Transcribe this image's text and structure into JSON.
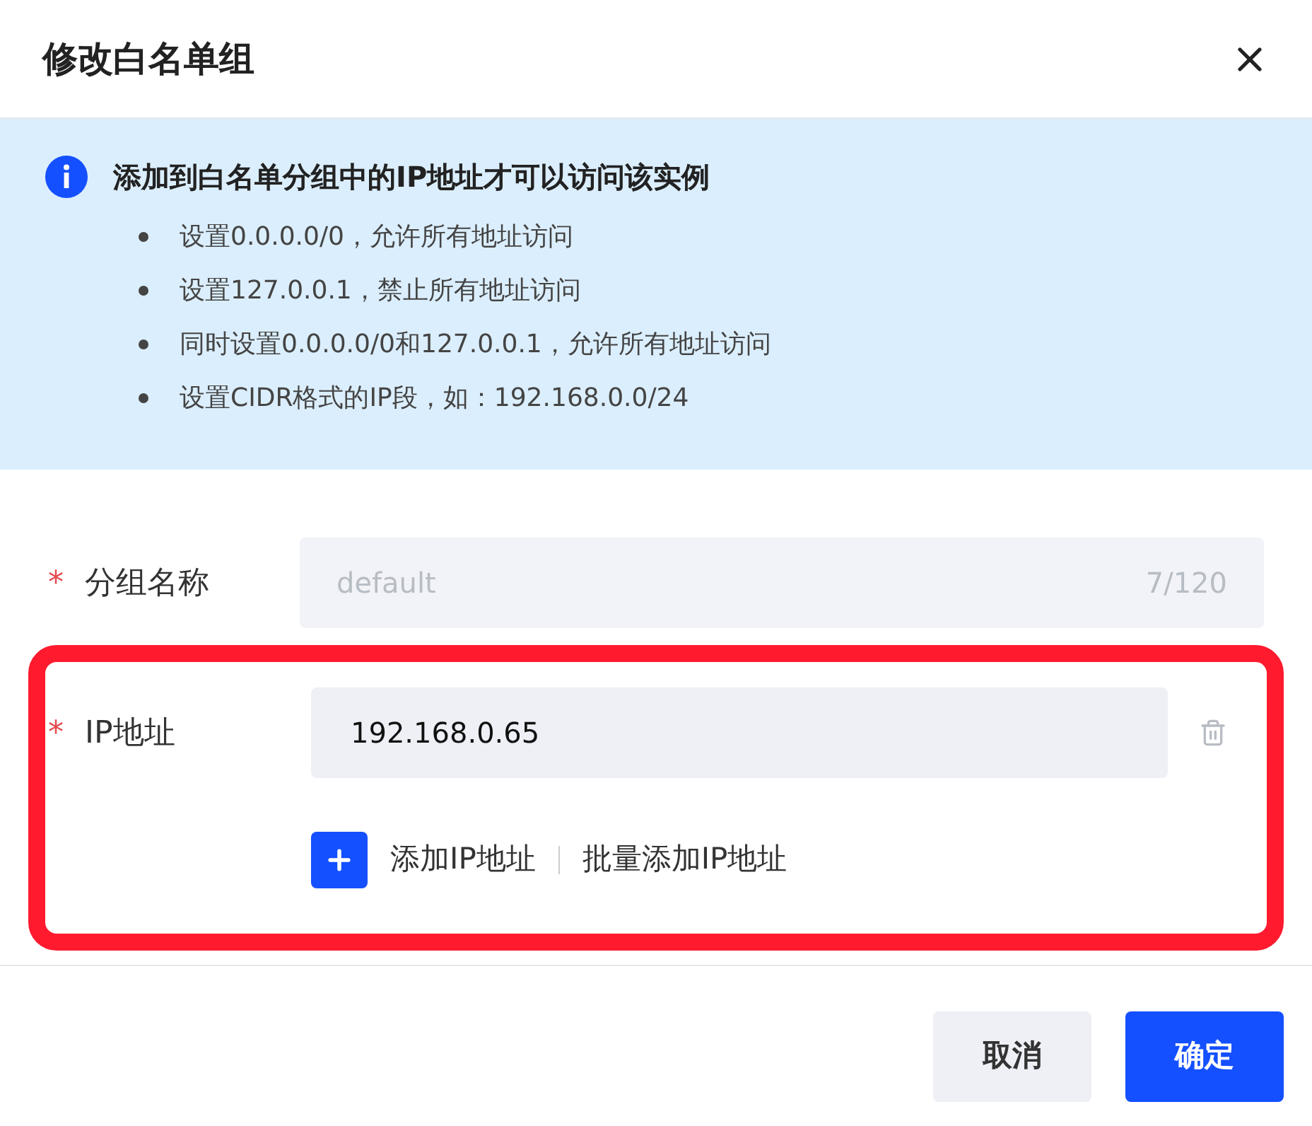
{
  "dialog": {
    "title": "修改白名单组"
  },
  "notice": {
    "title": "添加到白名单分组中的IP地址才可以访问该实例",
    "items": [
      "设置0.0.0.0/0，允许所有地址访问",
      "设置127.0.0.1，禁止所有地址访问",
      "同时设置0.0.0.0/0和127.0.0.1，允许所有地址访问",
      "设置CIDR格式的IP段，如：192.168.0.0/24"
    ]
  },
  "group_name": {
    "required_mark": "*",
    "label": "分组名称",
    "placeholder": "default",
    "counter": "7/120"
  },
  "ip_address": {
    "required_mark": "*",
    "label": "IP地址",
    "value": "192.168.0.65",
    "highlighted": true
  },
  "add_ip_link": "添加IP地址",
  "batch_add_link": "批量添加IP地址",
  "buttons": [
    {
      "label": "取消",
      "kind": "secondary"
    },
    {
      "label": "确定",
      "kind": "primary"
    }
  ]
}
